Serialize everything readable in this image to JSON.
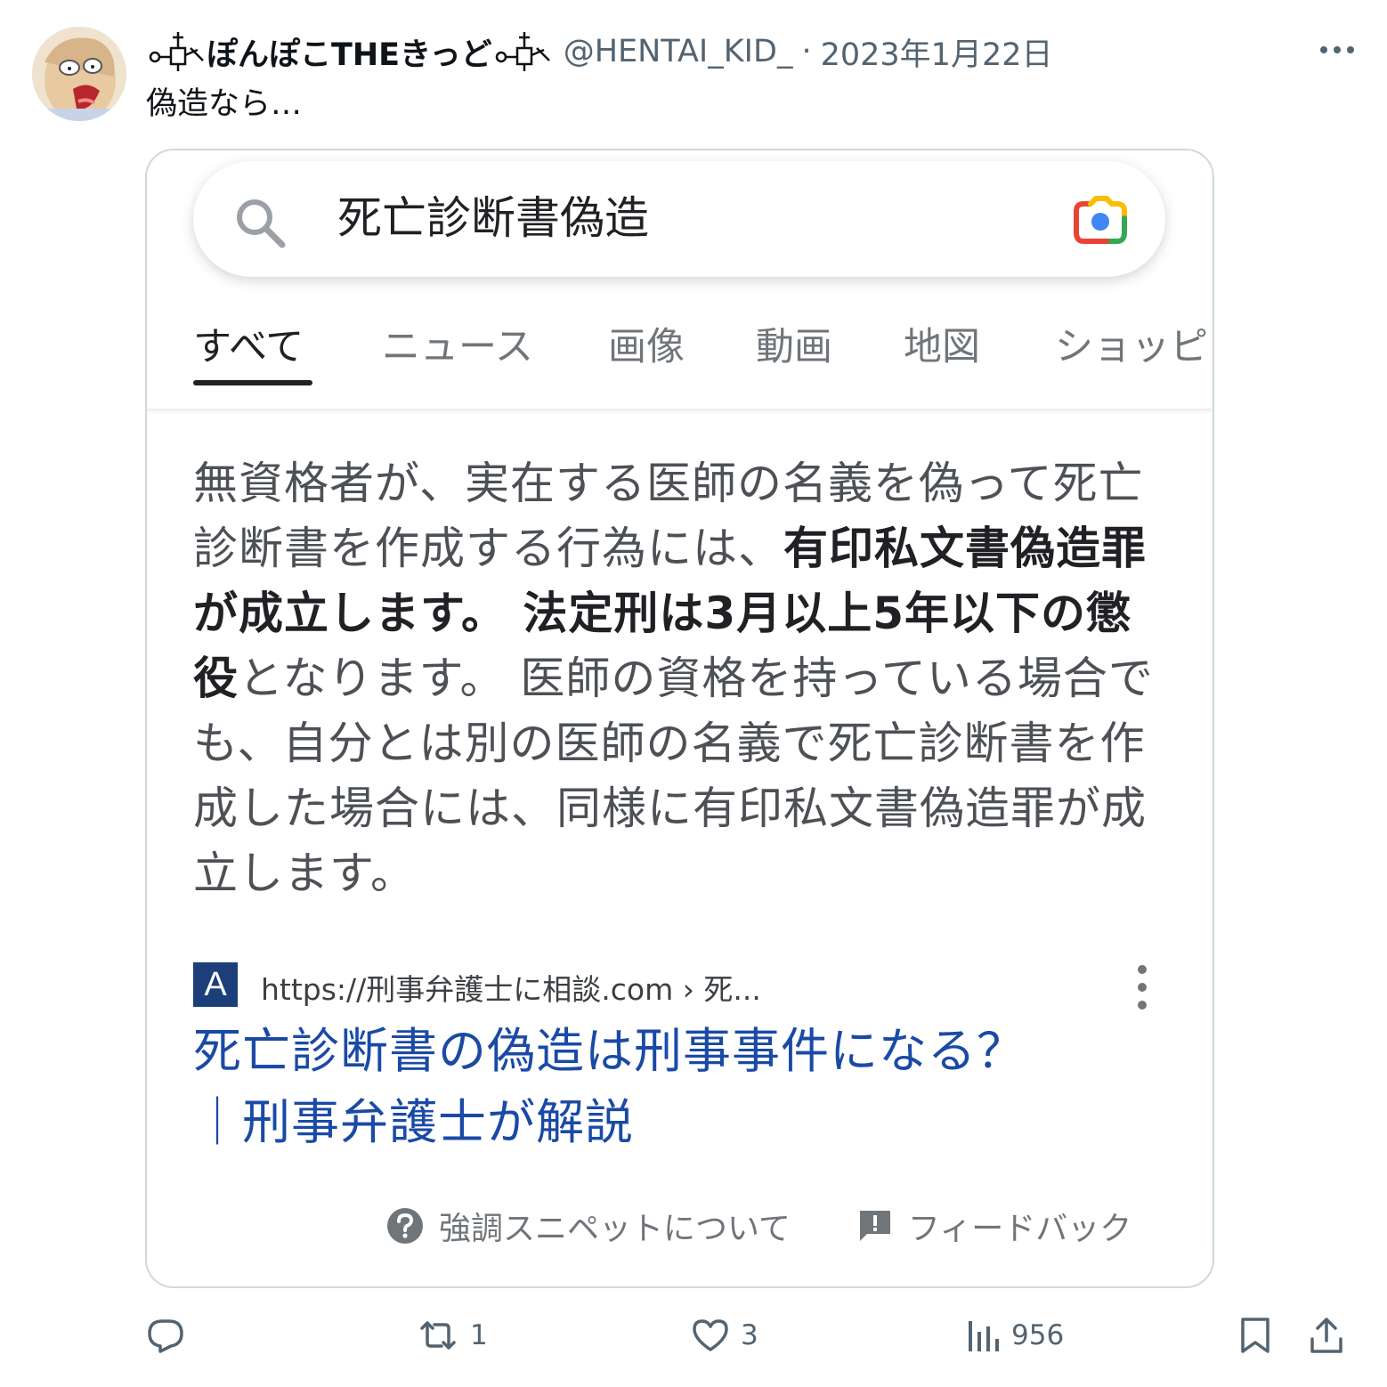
{
  "tweet": {
    "display_name": "ぽんぽこTHEきっど",
    "handle": "@HENTAI_KID_",
    "separator": "·",
    "date": "2023年1月22日",
    "text": "偽造なら…"
  },
  "screenshot": {
    "search_query": "死亡診断書偽造",
    "tabs": [
      "すべて",
      "ニュース",
      "画像",
      "動画",
      "地図",
      "ショッピ"
    ],
    "active_tab": "すべて",
    "snippet": {
      "part1": "無資格者が、実在する医師の名義を偽って死亡診断書を作成する行為には、",
      "bold1": "有印私文書偽造罪が成立します。 法定刑は3月以上5年以下の懲役",
      "part2": "となります。 医師の資格を持っている場合でも、自分とは別の医師の名義で死亡診断書を作成した場合には、同様に有印私文書偽造罪が成立します。"
    },
    "source_favicon_letter": "A",
    "source_url": "https://刑事弁護士に相談.com › 死...",
    "result_title_line1": "死亡診断書の偽造は刑事事件になる？",
    "result_title_line2": "｜刑事弁護士が解説",
    "footer_about": "強調スニペットについて",
    "footer_feedback": "フィードバック"
  },
  "actions": {
    "reply_count": "",
    "retweet_count": "1",
    "like_count": "3",
    "views_count": "956"
  },
  "colors": {
    "link_blue": "#1a4aa6",
    "text_gray": "#536471",
    "snippet_gray": "#4d5156"
  },
  "icons": [
    "search-icon",
    "google-lens-icon",
    "more-icon",
    "vertical-dots-icon",
    "question-icon",
    "feedback-icon",
    "reply-icon",
    "retweet-icon",
    "like-icon",
    "views-icon",
    "bookmark-icon",
    "share-icon"
  ]
}
